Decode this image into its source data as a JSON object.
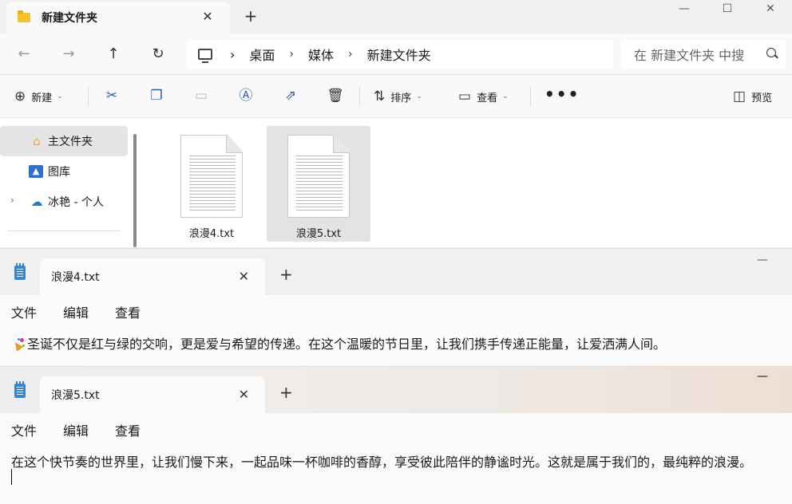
{
  "explorer": {
    "tab_title": "新建文件夹",
    "tab_close": "✕",
    "new_tab": "+",
    "window_controls": {
      "minimize": "—",
      "maximize": "☐",
      "close": "✕"
    },
    "nav": {
      "back": "←",
      "forward": "→",
      "up": "↑",
      "refresh": "↻"
    },
    "breadcrumb": [
      "桌面",
      "媒体",
      "新建文件夹"
    ],
    "breadcrumb_sep": "›",
    "search_placeholder": "在 新建文件夹 中搜",
    "commands": {
      "new": "新建",
      "sort": "排序",
      "view": "查看",
      "more": "•••",
      "preview": "预览"
    },
    "sidebar": [
      {
        "label": "主文件夹",
        "icon": "home-icon"
      },
      {
        "label": "图库",
        "icon": "gallery-icon"
      },
      {
        "label": "冰艳 - 个人",
        "icon": "onedrive-cloud-icon"
      }
    ],
    "expander": "›",
    "files": [
      {
        "name": "浪漫4.txt",
        "selected": false
      },
      {
        "name": "浪漫5.txt",
        "selected": true
      }
    ]
  },
  "notepad1": {
    "tab_title": "浪漫4.txt",
    "tab_close": "✕",
    "new_tab": "+",
    "minimize": "—",
    "menu": [
      "文件",
      "编辑",
      "查看"
    ],
    "text": "圣诞不仅是红与绿的交响，更是爱与希望的传递。在这个温暖的节日里，让我们携手传递正能量，让爱洒满人间。"
  },
  "notepad2": {
    "tab_title": "浪漫5.txt",
    "tab_close": "✕",
    "new_tab": "+",
    "minimize": "—",
    "menu": [
      "文件",
      "编辑",
      "查看"
    ],
    "text": "在这个快节奏的世界里，让我们慢下来，一起品味一杯咖啡的香醇，享受彼此陪伴的静谧时光。这就是属于我们的，最纯粹的浪漫。"
  }
}
